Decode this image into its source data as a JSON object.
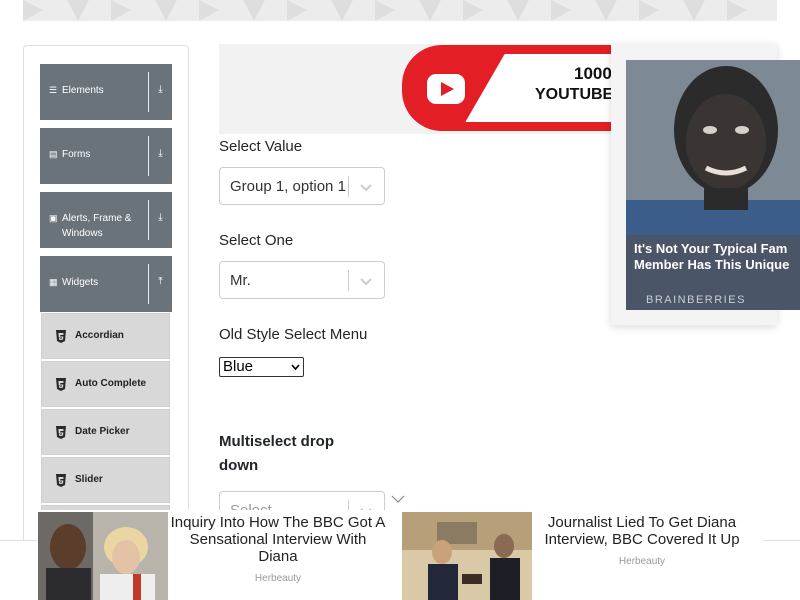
{
  "sidebar": {
    "groups": [
      {
        "label": "Elements",
        "icon": "list-icon",
        "arrow": "download-arrow-icon"
      },
      {
        "label": "Forms",
        "icon": "form-icon",
        "arrow": "download-arrow-icon"
      },
      {
        "label_line1": "Alerts, Frame &",
        "label_line2": "Windows",
        "icon": "window-icon",
        "arrow": "download-arrow-icon"
      },
      {
        "label": "Widgets",
        "icon": "grid-icon",
        "arrow": "upload-arrow-icon"
      }
    ],
    "widget_items": [
      {
        "label": "Accordian"
      },
      {
        "label": "Auto Complete"
      },
      {
        "label": "Date Picker"
      },
      {
        "label": "Slider"
      }
    ]
  },
  "form": {
    "select_value": {
      "label": "Select Value",
      "value": "Group 1, option 1"
    },
    "select_one": {
      "label": "Select One",
      "value": "Mr."
    },
    "old_style": {
      "label": "Old Style Select Menu",
      "value": "Blue"
    },
    "multiselect": {
      "label_line1": "Multiselect drop",
      "label_line2": "down",
      "placeholder": "Select..."
    }
  },
  "ads": {
    "youtube": {
      "text1": "1000",
      "text2": "YOUTUBE V"
    },
    "brainberries": {
      "title_line1": "It's Not Your Typical Fam",
      "title_line2": "Member Has This Unique",
      "source": "BRAINBERRIES"
    },
    "bottom": [
      {
        "title": "Inquiry Into How The BBC Got A Sensational Interview With Diana",
        "source": "Herbeauty"
      },
      {
        "title": "Journalist Lied To Get Diana Interview, BBC Covered It Up",
        "source": "Herbeauty"
      }
    ]
  },
  "colors": {
    "sidebar_group": "#6b737a",
    "sidebar_sub": "#d8d8d8",
    "youtube_red": "#e31e24"
  }
}
